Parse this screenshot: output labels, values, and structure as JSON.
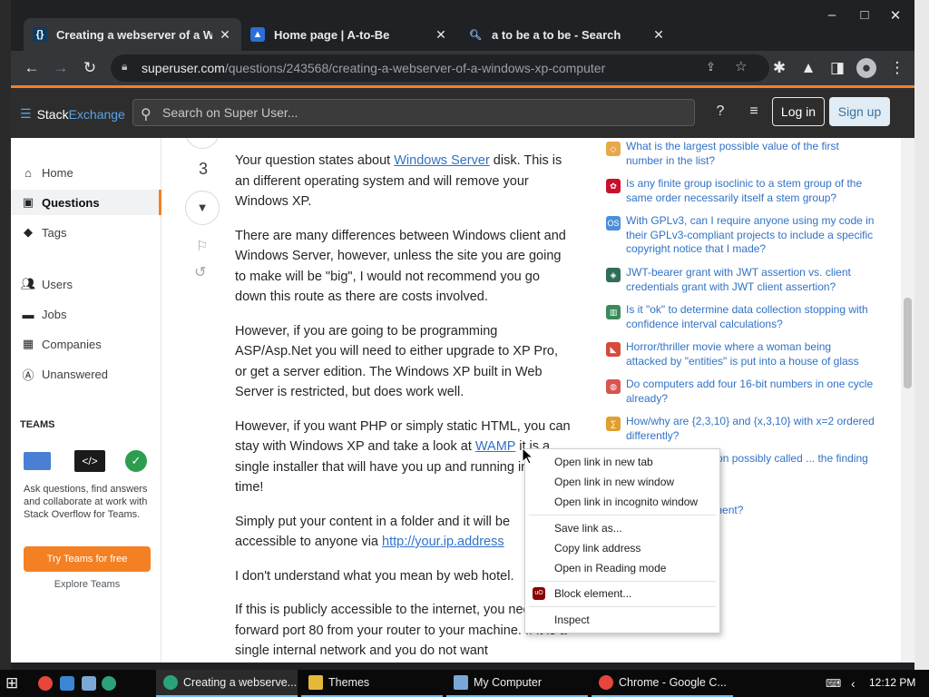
{
  "browser": {
    "tabs": [
      {
        "title": "Creating a webserver of a Windo",
        "active": true
      },
      {
        "title": "Home page | A-to-Be",
        "active": false
      },
      {
        "title": "a to be a to be - Search",
        "active": false
      }
    ],
    "url_host": "superuser.com",
    "url_path": "/questions/243568/creating-a-webserver-of-a-windows-xp-computer"
  },
  "site_header": {
    "logo_stack": "Stack",
    "logo_exchange": "Exchange",
    "search_placeholder": "Search on Super User...",
    "login_label": "Log in",
    "signup_label": "Sign up"
  },
  "left_nav": {
    "items": [
      {
        "label": "Home",
        "icon": "home-icon"
      },
      {
        "label": "Questions",
        "icon": "questions-icon"
      },
      {
        "label": "Tags",
        "icon": "tag-icon"
      },
      {
        "label": "Users",
        "icon": "users-icon"
      },
      {
        "label": "Jobs",
        "icon": "briefcase-icon"
      },
      {
        "label": "Companies",
        "icon": "building-icon"
      },
      {
        "label": "Unanswered",
        "icon": "unanswered-icon"
      }
    ],
    "teams_header": "TEAMS",
    "teams_description": "Ask questions, find answers and collaborate at work with Stack Overflow for Teams.",
    "try_teams_label": "Try Teams for free",
    "explore_teams_label": "Explore Teams"
  },
  "vote": {
    "count": "3"
  },
  "answer": {
    "p1_pre": "Your question states about ",
    "p1_link": "Windows Server",
    "p1_post": " disk. This is an different operating system and will remove your Windows XP.",
    "p2": "There are many differences between Windows client and Windows Server, however, unless the site you are going to make will be \"big\", I would not recommend you go down this route as there are costs involved.",
    "p3": "However, if you are going to be programming ASP/Asp.Net you will need to either upgrade to XP Pro, or get a server edition. The Windows XP built in Web Server is restricted, but does work well.",
    "p4_pre": "However, if you want PHP or simply static HTML, you can stay with Windows XP and take a look at ",
    "p4_link": "WAMP",
    "p4_post": " it is a single installer that will have you up and running in no time!",
    "p5_pre": "Simply put your content in a folder and it will be accessible to anyone via ",
    "p5_link": "http://your.ip.address",
    "p6": "I don't understand what you mean by web hotel.",
    "p7": "If this is publicly accessible to the internet, you need to forward port 80 from your router to your machine. If it is a single internal network and you do not want"
  },
  "related": [
    {
      "text": "What is the largest possible value of the first number in the list?",
      "color": "#e8a84a"
    },
    {
      "text": "Is any finite group isoclinic to a stem group of the same order necessarily itself a stem group?",
      "color": "#c8102e"
    },
    {
      "text": "With GPLv3, can I require anyone using my code in their GPLv3-compliant projects to include a specific copyright notice that I made?",
      "color": "#4a90d9"
    },
    {
      "text": "JWT-bearer grant with JWT assertion vs. client credentials grant with JWT client assertion?",
      "color": "#2f6e5a"
    },
    {
      "text": "Is it \"ok\" to determine data collection stopping with confidence interval calculations?",
      "color": "#3a8a5a"
    },
    {
      "text": "Horror/thriller movie where a woman being attacked by \"entities\" is put into a house of glass",
      "color": "#d64a3a"
    },
    {
      "text": "Do computers add four 16-bit numbers in one cycle already?",
      "color": "#d9534f"
    },
    {
      "text": "How/why are {2,3,10} and {x,3,10} with x=2 ordered differently?",
      "color": "#e0a030"
    },
    {
      "text": "Story about a religion possibly called ... the finding of a wrecked alien",
      "color": "#5a7ab8"
    },
    {
      "text": "fallacy in this argument?",
      "color": "#8a6ab8"
    }
  ],
  "context_menu": {
    "items": [
      "Open link in new tab",
      "Open link in new window",
      "Open link in incognito window",
      "Save link as...",
      "Copy link address",
      "Open in Reading mode",
      "Block element...",
      "Inspect"
    ]
  },
  "taskbar": {
    "apps": [
      {
        "label": "Creating a webserve...",
        "active": true
      },
      {
        "label": "Themes",
        "active": false
      },
      {
        "label": "My Computer",
        "active": false
      },
      {
        "label": "Chrome - Google C...",
        "active": false
      }
    ],
    "clock": "12:12 PM"
  }
}
